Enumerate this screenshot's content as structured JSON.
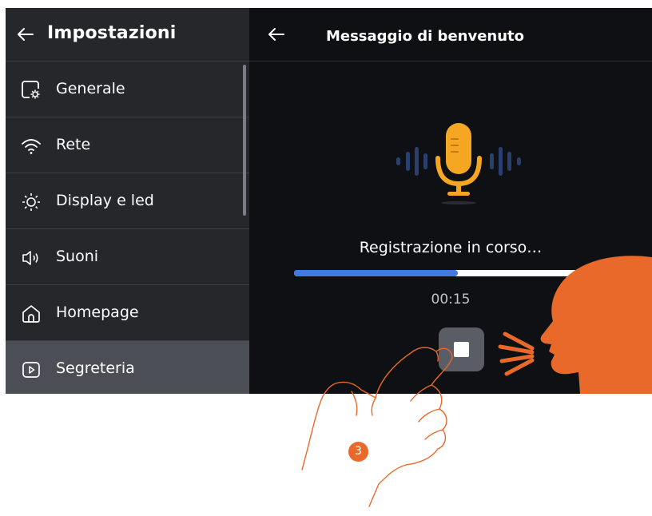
{
  "left_panel": {
    "title": "Impostazioni",
    "items": [
      {
        "label": "Generale",
        "icon": "settings-gear-icon"
      },
      {
        "label": "Rete",
        "icon": "wifi-icon"
      },
      {
        "label": "Display e led",
        "icon": "sun-icon"
      },
      {
        "label": "Suoni",
        "icon": "speaker-icon"
      },
      {
        "label": "Homepage",
        "icon": "home-icon"
      },
      {
        "label": "Segreteria",
        "icon": "play-icon",
        "active": true
      }
    ]
  },
  "right_panel": {
    "title": "Messaggio di benvenuto",
    "status": "Registrazione in corso…",
    "timer": "00:15",
    "progress": 0.57
  },
  "annotation": {
    "step_number": "3"
  },
  "colors": {
    "accent_mic": "#f5a623",
    "progress": "#3f7ae0",
    "illustration": "#e8692a"
  }
}
